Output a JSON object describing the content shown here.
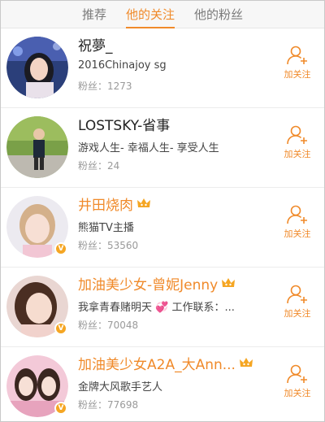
{
  "tabs": [
    {
      "label": "推荐"
    },
    {
      "label": "他的关注"
    },
    {
      "label": "他的粉丝"
    }
  ],
  "active_tab": 1,
  "users": [
    {
      "name": "祝夢_",
      "desc": "2016Chinajoy sg",
      "fans_label": "粉丝：",
      "fans": "1273",
      "follow_label": "加关注"
    },
    {
      "name": "LOSTSKY-省事",
      "desc": "游戏人生- 幸福人生- 享受人生",
      "fans_label": "粉丝：",
      "fans": "24",
      "follow_label": "加关注"
    },
    {
      "name": "井田烧肉",
      "desc": "熊猫TV主播",
      "fans_label": "粉丝：",
      "fans": "53560",
      "follow_label": "加关注"
    },
    {
      "name": "加油美少女-曾妮Jenny",
      "desc": "我拿青春赌明天 💞 工作联系：...",
      "fans_label": "粉丝：",
      "fans": "70048",
      "follow_label": "加关注"
    },
    {
      "name": "加油美少女A2A_大Ann...",
      "desc": "金牌大风歌手艺人",
      "fans_label": "粉丝：",
      "fans": "77698",
      "follow_label": "加关注"
    }
  ],
  "colors": {
    "accent": "#f08a2a",
    "verified": "#f5a623"
  }
}
